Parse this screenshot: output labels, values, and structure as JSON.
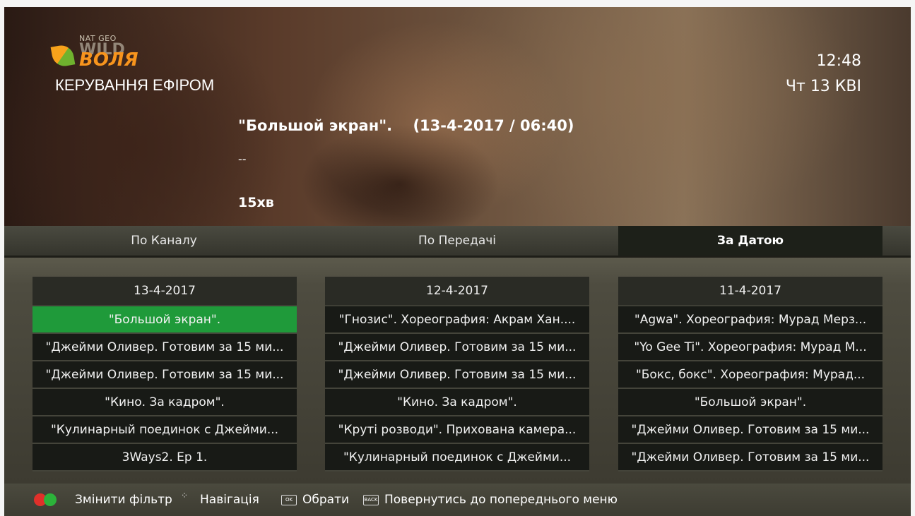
{
  "channel_logo": {
    "natgeo": "NAT GEO",
    "wild": "WILD",
    "brand": "ВОЛЯ"
  },
  "section_title": "КЕРУВАННЯ ЕФІРОМ",
  "clock": {
    "time": "12:48",
    "date": "Чт 13 КВІ"
  },
  "program": {
    "title": "\"Большой экран\".",
    "datetime": "(13-4-2017 / 06:40)",
    "description": "--",
    "duration": "15хв"
  },
  "tabs": [
    {
      "label": "По Каналу",
      "active": false
    },
    {
      "label": "По Передачі",
      "active": false
    },
    {
      "label": "За Датою",
      "active": true
    }
  ],
  "columns": [
    {
      "date": "13-4-2017",
      "items": [
        "\"Большой экран\".",
        "\"Джейми Оливер. Готовим за 15 ми...",
        "\"Джейми Оливер. Готовим за 15 ми...",
        "\"Кино. За кадром\".",
        "\"Кулинарный поединок с Джейми...",
        "3Ways2. Ep 1."
      ]
    },
    {
      "date": "12-4-2017",
      "items": [
        "\"Гнозис\". Хореография: Акрам Хан....",
        "\"Джейми Оливер. Готовим за 15 ми...",
        "\"Джейми Оливер. Готовим за 15 ми...",
        "\"Кино. За кадром\".",
        "\"Круті розводи\". Прихована камера...",
        "\"Кулинарный поединок с Джейми..."
      ]
    },
    {
      "date": "11-4-2017",
      "items": [
        "\"Agwa\". Хореография: Мурад Мерз...",
        "\"Yo Gee Ti\". Хореография: Мурад М...",
        "\"Бокс, бокс\". Хореография: Мурад...",
        "\"Большой экран\".",
        "\"Джейми Оливер. Готовим за 15 ми...",
        "\"Джейми Оливер. Готовим за 15 ми..."
      ]
    }
  ],
  "footer": {
    "change_filter": "Змінити фільтр",
    "navigation": "Навігація",
    "ok_key": "OK",
    "select": "Обрати",
    "back_key": "BACK",
    "back": "Повернутись до попереднього меню"
  },
  "colors": {
    "selected": "#1f9a3a",
    "red_button": "#e0302a",
    "green_button": "#2cb23a",
    "brand_orange": "#f7941d"
  }
}
